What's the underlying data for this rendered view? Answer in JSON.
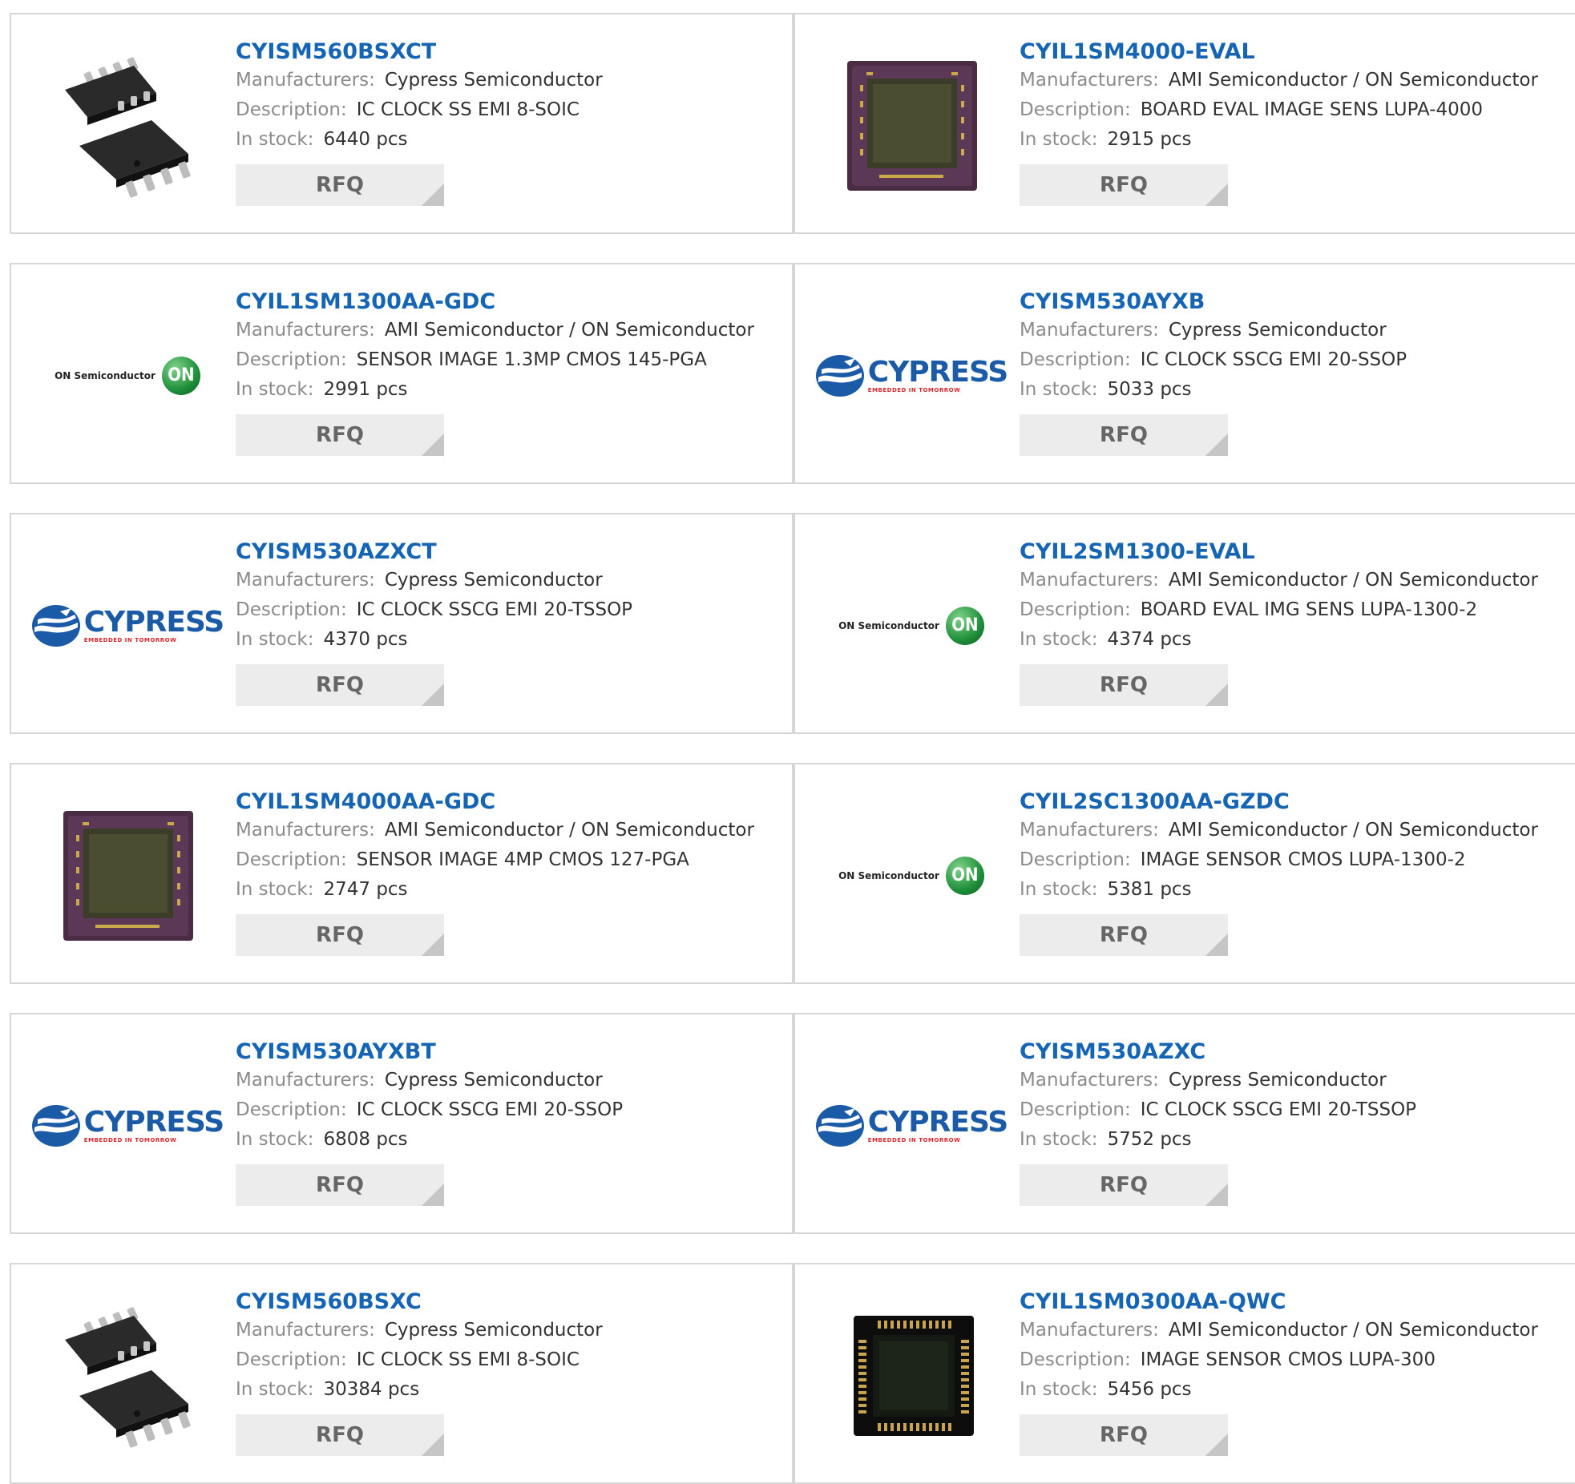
{
  "labels": {
    "manufacturers": "Manufacturers:",
    "description": "Description:",
    "in_stock": "In stock:",
    "rfq": "RFQ"
  },
  "logos": {
    "on_text": "ON Semiconductor",
    "on_mark": "ON",
    "cypress_text": "CYPRESS",
    "cypress_tag": "EMBEDDED IN TOMORROW"
  },
  "colors": {
    "part_link": "#1565b4",
    "label_gray": "#8c8c8c",
    "value_dark": "#333333",
    "rfq_bg": "#ececec",
    "border": "#d6d6d6"
  },
  "products": [
    {
      "part": "CYISM560BSXCT",
      "manufacturer": "Cypress Semiconductor",
      "description": "IC CLOCK SS EMI 8-SOIC",
      "stock": "6440 pcs",
      "image": "soic-chip"
    },
    {
      "part": "CYIL1SM4000-EVAL",
      "manufacturer": "AMI Semiconductor / ON Semiconductor",
      "description": "BOARD EVAL IMAGE SENS LUPA-4000",
      "stock": "2915 pcs",
      "image": "sensor-chip"
    },
    {
      "part": "CYIL1SM1300AA-GDC",
      "manufacturer": "AMI Semiconductor / ON Semiconductor",
      "description": "SENSOR IMAGE 1.3MP CMOS 145-PGA",
      "stock": "2991 pcs",
      "image": "on-logo"
    },
    {
      "part": "CYISM530AYXB",
      "manufacturer": "Cypress Semiconductor",
      "description": "IC CLOCK SSCG EMI 20-SSOP",
      "stock": "5033 pcs",
      "image": "cypress-logo"
    },
    {
      "part": "CYISM530AZXCT",
      "manufacturer": "Cypress Semiconductor",
      "description": "IC CLOCK SSCG EMI 20-TSSOP",
      "stock": "4370 pcs",
      "image": "cypress-logo"
    },
    {
      "part": "CYIL2SM1300-EVAL",
      "manufacturer": "AMI Semiconductor / ON Semiconductor",
      "description": "BOARD EVAL IMG SENS LUPA-1300-2",
      "stock": "4374 pcs",
      "image": "on-logo"
    },
    {
      "part": "CYIL1SM4000AA-GDC",
      "manufacturer": "AMI Semiconductor / ON Semiconductor",
      "description": "SENSOR IMAGE 4MP CMOS 127-PGA",
      "stock": "2747 pcs",
      "image": "sensor-chip"
    },
    {
      "part": "CYIL2SC1300AA-GZDC",
      "manufacturer": "AMI Semiconductor / ON Semiconductor",
      "description": "IMAGE SENSOR CMOS LUPA-1300-2",
      "stock": "5381 pcs",
      "image": "on-logo"
    },
    {
      "part": "CYISM530AYXBT",
      "manufacturer": "Cypress Semiconductor",
      "description": "IC CLOCK SSCG EMI 20-SSOP",
      "stock": "6808 pcs",
      "image": "cypress-logo"
    },
    {
      "part": "CYISM530AZXC",
      "manufacturer": "Cypress Semiconductor",
      "description": "IC CLOCK SSCG EMI 20-TSSOP",
      "stock": "5752 pcs",
      "image": "cypress-logo"
    },
    {
      "part": "CYISM560BSXC",
      "manufacturer": "Cypress Semiconductor",
      "description": "IC CLOCK SS EMI 8-SOIC",
      "stock": "30384 pcs",
      "image": "soic-chip"
    },
    {
      "part": "CYIL1SM0300AA-QWC",
      "manufacturer": "AMI Semiconductor / ON Semiconductor",
      "description": "IMAGE SENSOR CMOS LUPA-300",
      "stock": "5456 pcs",
      "image": "lcc-chip"
    }
  ]
}
